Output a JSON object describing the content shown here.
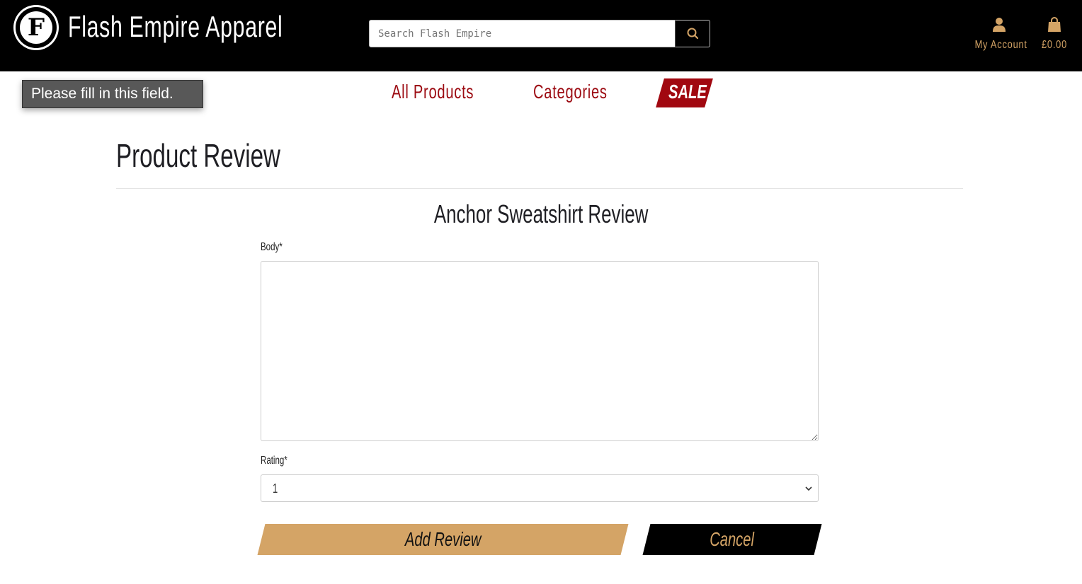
{
  "header": {
    "brand_name": "Flash Empire Apparel",
    "logo_monogram": "F",
    "search": {
      "placeholder": "Search Flash Empire",
      "value": ""
    },
    "account_label": "My Account",
    "cart_total": "£0.00"
  },
  "tooltip": {
    "text": "Please fill in this field."
  },
  "nav": {
    "all_products": "All Products",
    "categories": "Categories",
    "sale": "SALE"
  },
  "page": {
    "title": "Product Review",
    "form_title": "Anchor Sweatshirt Review",
    "body_label": "Body*",
    "body_value": "",
    "rating_label": "Rating*",
    "rating_selected": "1",
    "add_button": "Add Review",
    "cancel_button": "Cancel"
  },
  "colors": {
    "header_bg": "#000000",
    "accent_gold": "#d4a466",
    "brand_red": "#9c0b12",
    "sale_red": "#a10810"
  },
  "icons": {
    "search": "search-icon",
    "account": "user-icon",
    "cart": "shopping-bag-icon",
    "rating_dropdown": "chevron-down-icon"
  }
}
